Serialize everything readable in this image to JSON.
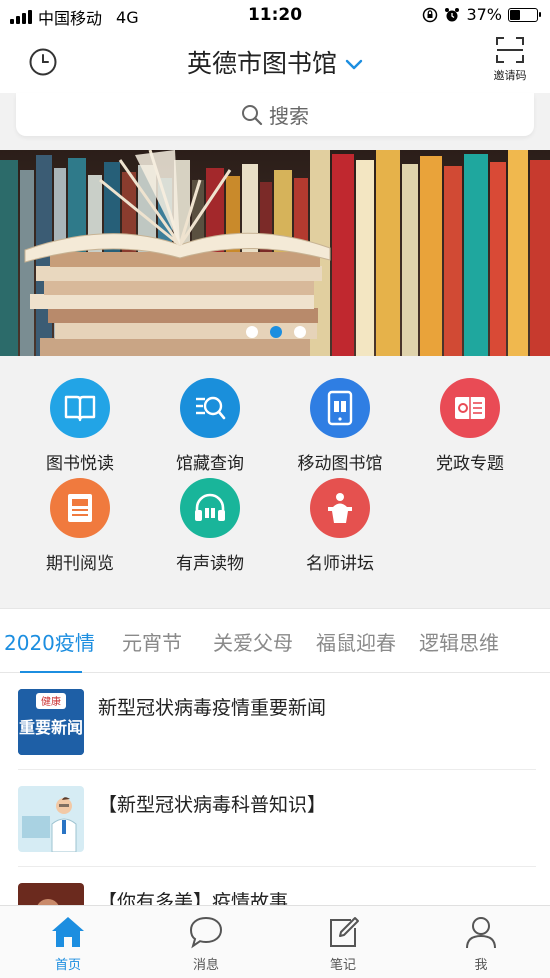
{
  "status_bar": {
    "carrier": "中国移动",
    "network": "4G",
    "time": "11:20",
    "battery": "37%",
    "battery_level": 0.37
  },
  "navbar": {
    "title": "英德市图书馆",
    "invite_label": "邀请码",
    "history_icon": "clock-icon",
    "scan_icon": "scan-icon"
  },
  "search": {
    "placeholder": "搜索"
  },
  "banner": {
    "slide_count": 3,
    "active_index": 1
  },
  "functions": [
    {
      "label": "图书悦读",
      "icon": "book-icon",
      "color": "#22a4e6"
    },
    {
      "label": "馆藏查询",
      "icon": "search-list-icon",
      "color": "#1a8fdb"
    },
    {
      "label": "移动图书馆",
      "icon": "phone-book-icon",
      "color": "#2f7ee3"
    },
    {
      "label": "党政专题",
      "icon": "party-flag-icon",
      "color": "#e94b55"
    },
    {
      "label": "期刊阅览",
      "icon": "journal-icon",
      "color": "#f07a3e"
    },
    {
      "label": "有声读物",
      "icon": "headphones-icon",
      "color": "#19b59a"
    },
    {
      "label": "名师讲坛",
      "icon": "podium-icon",
      "color": "#e5514f"
    }
  ],
  "tabs": [
    "2020疫情",
    "元宵节",
    "关爱父母",
    "福鼠迎春",
    "逻辑思维"
  ],
  "active_tab": 0,
  "news": [
    {
      "title": "新型冠状病毒疫情重要新闻",
      "thumb_text": "重要新闻",
      "thumb_top": "健康"
    },
    {
      "title": "【新型冠状病毒科普知识】"
    },
    {
      "title": "【你有多美】疫情故事"
    }
  ],
  "bottom_tabs": [
    {
      "label": "首页",
      "icon": "home-icon"
    },
    {
      "label": "消息",
      "icon": "message-icon"
    },
    {
      "label": "笔记",
      "icon": "note-icon"
    },
    {
      "label": "我",
      "icon": "user-icon"
    }
  ],
  "active_bottom_tab": 0,
  "colors": {
    "accent": "#1c8ee0",
    "background": "#f2f2f2"
  }
}
